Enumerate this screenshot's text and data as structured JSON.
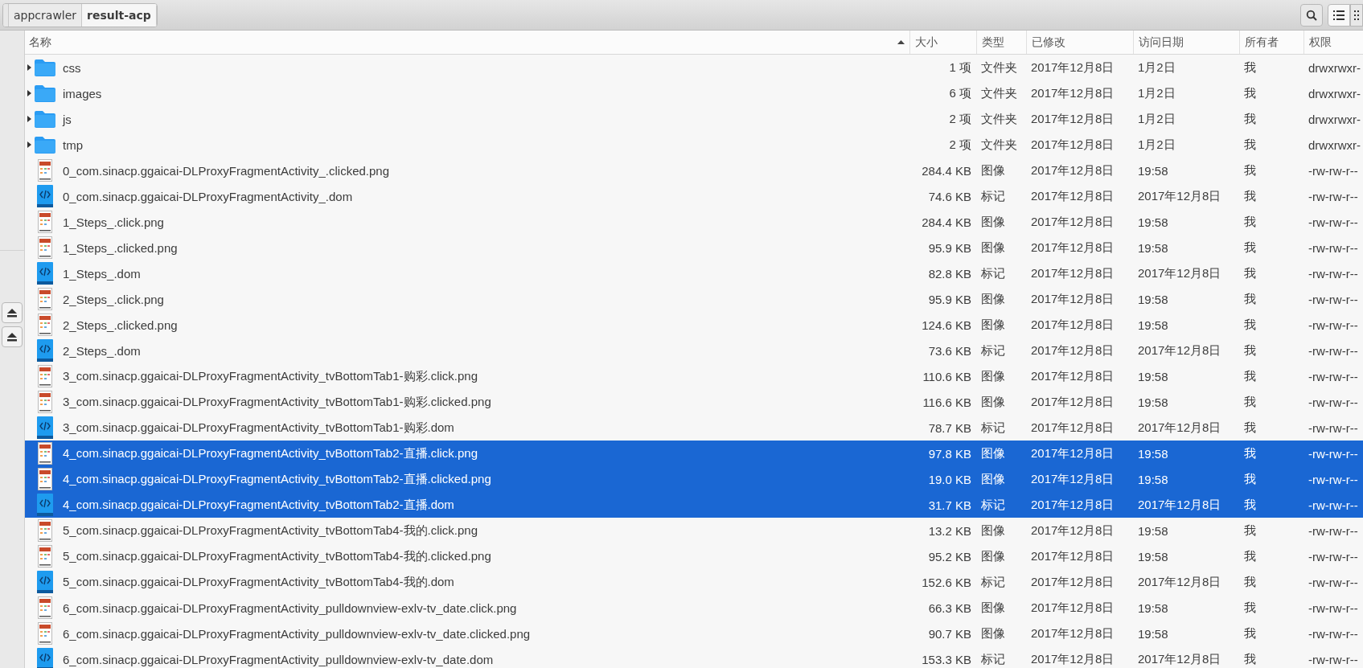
{
  "breadcrumb": [
    {
      "label": "appcrawler",
      "selected": false
    },
    {
      "label": "result-acp",
      "selected": true
    }
  ],
  "view_buttons": [
    {
      "kind": "list",
      "selected": true
    },
    {
      "kind": "grid",
      "selected": false
    }
  ],
  "columns": [
    {
      "label": "名称",
      "sorted": true
    },
    {
      "label": "大小",
      "sorted": false
    },
    {
      "label": "类型",
      "sorted": false
    },
    {
      "label": "已修改",
      "sorted": false
    },
    {
      "label": "访问日期",
      "sorted": false
    },
    {
      "label": "所有者",
      "sorted": false
    },
    {
      "label": "权限",
      "sorted": false
    }
  ],
  "rows": [
    {
      "kind": "folder",
      "name": "css",
      "size": "1 项",
      "type": "文件夹",
      "modified": "2017年12月8日",
      "accessed": "1月2日",
      "owner": "我",
      "permissions": "drwxrwxr-",
      "selected": false,
      "expanded": false
    },
    {
      "kind": "folder",
      "name": "images",
      "size": "6 项",
      "type": "文件夹",
      "modified": "2017年12月8日",
      "accessed": "1月2日",
      "owner": "我",
      "permissions": "drwxrwxr-",
      "selected": false,
      "expanded": false
    },
    {
      "kind": "folder",
      "name": "js",
      "size": "2 项",
      "type": "文件夹",
      "modified": "2017年12月8日",
      "accessed": "1月2日",
      "owner": "我",
      "permissions": "drwxrwxr-",
      "selected": false,
      "expanded": false
    },
    {
      "kind": "folder",
      "name": "tmp",
      "size": "2 项",
      "type": "文件夹",
      "modified": "2017年12月8日",
      "accessed": "1月2日",
      "owner": "我",
      "permissions": "drwxrwxr-",
      "selected": false,
      "expanded": false
    },
    {
      "kind": "image",
      "name": "0_com.sinacp.ggaicai-DLProxyFragmentActivity_.clicked.png",
      "size": "284.4 KB",
      "type": "图像",
      "modified": "2017年12月8日",
      "accessed": "19:58",
      "owner": "我",
      "permissions": "-rw-rw-r--",
      "selected": false
    },
    {
      "kind": "markup",
      "name": "0_com.sinacp.ggaicai-DLProxyFragmentActivity_.dom",
      "size": "74.6 KB",
      "type": "标记",
      "modified": "2017年12月8日",
      "accessed": "2017年12月8日",
      "owner": "我",
      "permissions": "-rw-rw-r--",
      "selected": false
    },
    {
      "kind": "image",
      "name": "1_Steps_.click.png",
      "size": "284.4 KB",
      "type": "图像",
      "modified": "2017年12月8日",
      "accessed": "19:58",
      "owner": "我",
      "permissions": "-rw-rw-r--",
      "selected": false
    },
    {
      "kind": "image",
      "name": "1_Steps_.clicked.png",
      "size": "95.9 KB",
      "type": "图像",
      "modified": "2017年12月8日",
      "accessed": "19:58",
      "owner": "我",
      "permissions": "-rw-rw-r--",
      "selected": false
    },
    {
      "kind": "markup",
      "name": "1_Steps_.dom",
      "size": "82.8 KB",
      "type": "标记",
      "modified": "2017年12月8日",
      "accessed": "2017年12月8日",
      "owner": "我",
      "permissions": "-rw-rw-r--",
      "selected": false
    },
    {
      "kind": "image",
      "name": "2_Steps_.click.png",
      "size": "95.9 KB",
      "type": "图像",
      "modified": "2017年12月8日",
      "accessed": "19:58",
      "owner": "我",
      "permissions": "-rw-rw-r--",
      "selected": false
    },
    {
      "kind": "image",
      "name": "2_Steps_.clicked.png",
      "size": "124.6 KB",
      "type": "图像",
      "modified": "2017年12月8日",
      "accessed": "19:58",
      "owner": "我",
      "permissions": "-rw-rw-r--",
      "selected": false
    },
    {
      "kind": "markup",
      "name": "2_Steps_.dom",
      "size": "73.6 KB",
      "type": "标记",
      "modified": "2017年12月8日",
      "accessed": "2017年12月8日",
      "owner": "我",
      "permissions": "-rw-rw-r--",
      "selected": false
    },
    {
      "kind": "image",
      "name": "3_com.sinacp.ggaicai-DLProxyFragmentActivity_tvBottomTab1-购彩.click.png",
      "size": "110.6 KB",
      "type": "图像",
      "modified": "2017年12月8日",
      "accessed": "19:58",
      "owner": "我",
      "permissions": "-rw-rw-r--",
      "selected": false
    },
    {
      "kind": "image",
      "name": "3_com.sinacp.ggaicai-DLProxyFragmentActivity_tvBottomTab1-购彩.clicked.png",
      "size": "116.6 KB",
      "type": "图像",
      "modified": "2017年12月8日",
      "accessed": "19:58",
      "owner": "我",
      "permissions": "-rw-rw-r--",
      "selected": false
    },
    {
      "kind": "markup",
      "name": "3_com.sinacp.ggaicai-DLProxyFragmentActivity_tvBottomTab1-购彩.dom",
      "size": "78.7 KB",
      "type": "标记",
      "modified": "2017年12月8日",
      "accessed": "2017年12月8日",
      "owner": "我",
      "permissions": "-rw-rw-r--",
      "selected": false
    },
    {
      "kind": "image",
      "name": "4_com.sinacp.ggaicai-DLProxyFragmentActivity_tvBottomTab2-直播.click.png",
      "size": "97.8 KB",
      "type": "图像",
      "modified": "2017年12月8日",
      "accessed": "19:58",
      "owner": "我",
      "permissions": "-rw-rw-r--",
      "selected": true
    },
    {
      "kind": "image",
      "name": "4_com.sinacp.ggaicai-DLProxyFragmentActivity_tvBottomTab2-直播.clicked.png",
      "size": "19.0 KB",
      "type": "图像",
      "modified": "2017年12月8日",
      "accessed": "19:58",
      "owner": "我",
      "permissions": "-rw-rw-r--",
      "selected": true
    },
    {
      "kind": "markup",
      "name": "4_com.sinacp.ggaicai-DLProxyFragmentActivity_tvBottomTab2-直播.dom",
      "size": "31.7 KB",
      "type": "标记",
      "modified": "2017年12月8日",
      "accessed": "2017年12月8日",
      "owner": "我",
      "permissions": "-rw-rw-r--",
      "selected": true
    },
    {
      "kind": "image",
      "name": "5_com.sinacp.ggaicai-DLProxyFragmentActivity_tvBottomTab4-我的.click.png",
      "size": "13.2 KB",
      "type": "图像",
      "modified": "2017年12月8日",
      "accessed": "19:58",
      "owner": "我",
      "permissions": "-rw-rw-r--",
      "selected": false
    },
    {
      "kind": "image",
      "name": "5_com.sinacp.ggaicai-DLProxyFragmentActivity_tvBottomTab4-我的.clicked.png",
      "size": "95.2 KB",
      "type": "图像",
      "modified": "2017年12月8日",
      "accessed": "19:58",
      "owner": "我",
      "permissions": "-rw-rw-r--",
      "selected": false
    },
    {
      "kind": "markup",
      "name": "5_com.sinacp.ggaicai-DLProxyFragmentActivity_tvBottomTab4-我的.dom",
      "size": "152.6 KB",
      "type": "标记",
      "modified": "2017年12月8日",
      "accessed": "2017年12月8日",
      "owner": "我",
      "permissions": "-rw-rw-r--",
      "selected": false
    },
    {
      "kind": "image",
      "name": "6_com.sinacp.ggaicai-DLProxyFragmentActivity_pulldownview-exlv-tv_date.click.png",
      "size": "66.3 KB",
      "type": "图像",
      "modified": "2017年12月8日",
      "accessed": "19:58",
      "owner": "我",
      "permissions": "-rw-rw-r--",
      "selected": false
    },
    {
      "kind": "image",
      "name": "6_com.sinacp.ggaicai-DLProxyFragmentActivity_pulldownview-exlv-tv_date.clicked.png",
      "size": "90.7 KB",
      "type": "图像",
      "modified": "2017年12月8日",
      "accessed": "19:58",
      "owner": "我",
      "permissions": "-rw-rw-r--",
      "selected": false
    },
    {
      "kind": "markup",
      "name": "6_com.sinacp.ggaicai-DLProxyFragmentActivity_pulldownview-exlv-tv_date.dom",
      "size": "153.3 KB",
      "type": "标记",
      "modified": "2017年12月8日",
      "accessed": "2017年12月8日",
      "owner": "我",
      "permissions": "-rw-rw-r--",
      "selected": false
    }
  ]
}
